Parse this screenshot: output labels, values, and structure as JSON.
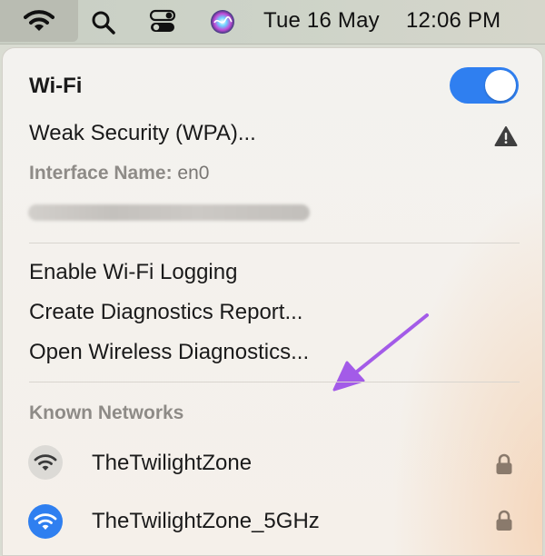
{
  "menubar": {
    "date": "Tue 16 May",
    "time": "12:06 PM",
    "icons": [
      "wifi-icon",
      "search-icon",
      "control-center-icon",
      "siri-icon"
    ]
  },
  "panel": {
    "title": "Wi-Fi",
    "toggle_on": true,
    "network_status": "Weak Security (WPA)...",
    "interface_label": "Interface Name:",
    "interface_value": "en0",
    "menu_items": [
      "Enable Wi-Fi Logging",
      "Create Diagnostics Report...",
      "Open Wireless Diagnostics..."
    ],
    "known_networks_header": "Known Networks",
    "networks": [
      {
        "name": "TheTwilightZone",
        "connected": false,
        "locked": true
      },
      {
        "name": "TheTwilightZone_5GHz",
        "connected": true,
        "locked": true
      }
    ]
  },
  "colors": {
    "accent": "#2f7ff0",
    "annotation_arrow": "#a35be8"
  }
}
